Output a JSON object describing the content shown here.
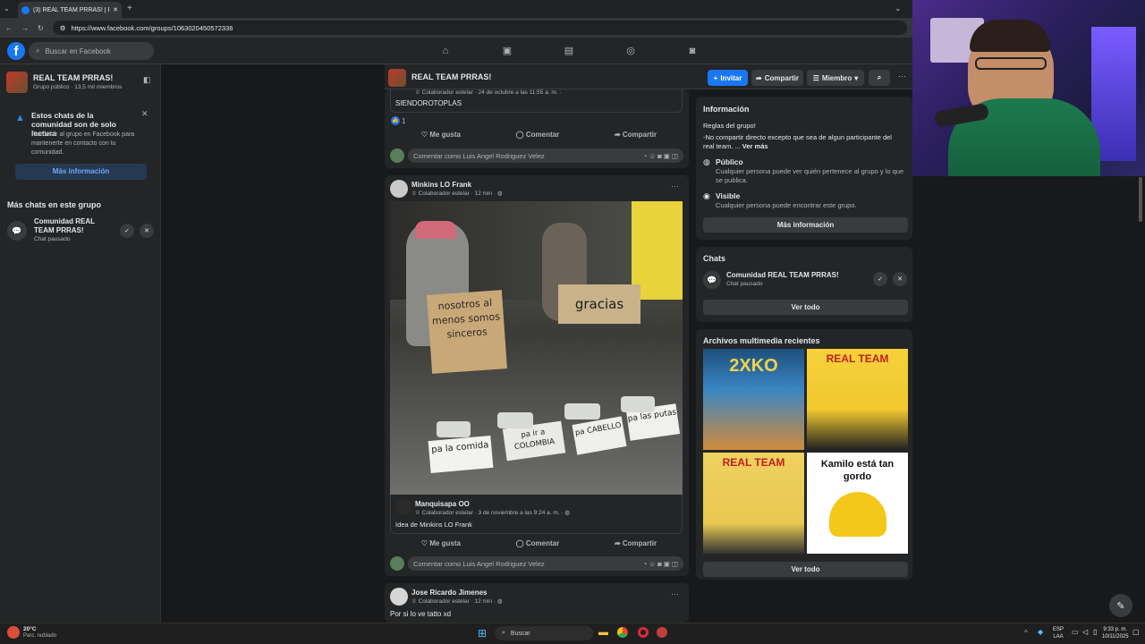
{
  "browser": {
    "tab_title": "(3) REAL TEAM PRRAS! | Facebo",
    "url": "https://www.facebook.com/groups/1063020450572336"
  },
  "fb": {
    "logo": "f",
    "search_placeholder": "Buscar en Facebook"
  },
  "left": {
    "group_name": "REAL TEAM PRRAS!",
    "group_meta": "Grupo público · 13,5 mil miembros",
    "notice_title": "Estos chats de la comunidad son de solo lectura",
    "notice_body": "Puedes ir al grupo en Facebook para mantenerte en contacto con tu comunidad.",
    "more_info": "Más información",
    "more_chats": "Más chats en este grupo",
    "chat_name": "Comunidad REAL TEAM PRRAS!",
    "chat_status": "Chat pausado"
  },
  "feed_header": {
    "title": "REAL TEAM PRRAS!",
    "invite": "Invitar",
    "share": "Compartir",
    "member": "Miembro"
  },
  "post1": {
    "badge": "Colaborador estelar",
    "date": "· 24 de octubre a las 11:55 a. m. ·",
    "text": "SIENDOROTOPLAS",
    "reactions": "1",
    "like": "Me gusta",
    "comment": "Comentar",
    "share": "Compartir",
    "comment_placeholder": "Comentar como Luis Angel Rodriguez Velez"
  },
  "post2": {
    "author": "Minkins LO Frank",
    "badge": "Colaborador estelar",
    "time": "· 12 min ·",
    "image_signs": [
      "nosotros al menos somos sinceros",
      "gracias",
      "pa la comida",
      "pa ir a COLOMBIA",
      "pa CABELLO",
      "pa las putas"
    ],
    "shared_author": "Manquisapa OO",
    "shared_badge": "Colaborador estelar",
    "shared_date": "· 3 de noviembre a las 9:24 a. m. ·",
    "shared_text": "Idea de Minkins LO Frank",
    "like": "Me gusta",
    "comment": "Comentar",
    "share": "Compartir",
    "comment_placeholder": "Comentar como Luis Angel Rodriguez Velez"
  },
  "post3": {
    "author": "Jose Ricardo Jimenes",
    "badge": "Colaborador estelar",
    "time": "· 12 min ·",
    "text": "Por si lo ve tatto xd"
  },
  "right": {
    "info_title": "Información",
    "rules": "Reglas del grupo!",
    "rules_text": "-No compartir directo excepto que sea de algun participante del real team. ...",
    "see_more": "Ver más",
    "public_title": "Público",
    "public_text": "Cualquier persona puede ver quién pertenece al grupo y lo que se publica.",
    "visible_title": "Visible",
    "visible_text": "Cualquier persona puede encontrar este grupo.",
    "more_info": "Más información",
    "chats_title": "Chats",
    "chat_name": "Comunidad REAL TEAM PRRAS!",
    "chat_status": "Chat pausado",
    "see_all": "Ver todo",
    "media_title": "Archivos multimedia recientes",
    "media_captions": [
      "2XKO",
      "REAL TEAM",
      "REAL TEAM",
      "Kamilo está tan gordo"
    ],
    "media_see_all": "Ver todo"
  },
  "taskbar": {
    "temp": "20°C",
    "weather": "Parc. nublado",
    "search": "Buscar",
    "lang1": "ESP",
    "lang2": "LAA",
    "time": "9:33 p. m.",
    "date": "10/11/2025"
  },
  "colors": {
    "fb_blue": "#1877f2",
    "bg": "#18191a",
    "card": "#242526"
  }
}
